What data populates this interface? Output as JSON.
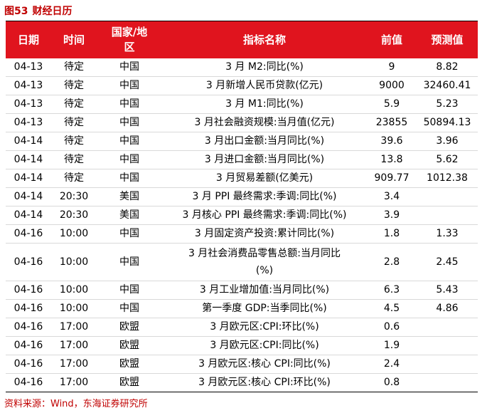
{
  "figure": {
    "number": "图53",
    "title": "财经日历"
  },
  "table": {
    "headers": [
      "日期",
      "时间",
      "国家/地区",
      "指标名称",
      "前值",
      "预测值"
    ],
    "rows": [
      [
        "04-13",
        "待定",
        "中国",
        "3 月 M2:同比(%)",
        "9",
        "8.82"
      ],
      [
        "04-13",
        "待定",
        "中国",
        "3 月新增人民币贷款(亿元)",
        "9000",
        "32460.41"
      ],
      [
        "04-13",
        "待定",
        "中国",
        "3 月 M1:同比(%)",
        "5.9",
        "5.23"
      ],
      [
        "04-13",
        "待定",
        "中国",
        "3 月社会融资规模:当月值(亿元)",
        "23855",
        "50894.13"
      ],
      [
        "04-14",
        "待定",
        "中国",
        "3 月出口金额:当月同比(%)",
        "39.6",
        "3.96"
      ],
      [
        "04-14",
        "待定",
        "中国",
        "3 月进口金额:当月同比(%)",
        "13.8",
        "5.62"
      ],
      [
        "04-14",
        "待定",
        "中国",
        "3 月贸易差额(亿美元)",
        "909.77",
        "1012.38"
      ],
      [
        "04-14",
        "20:30",
        "美国",
        "3 月 PPI 最终需求:季调:同比(%)",
        "3.4",
        ""
      ],
      [
        "04-14",
        "20:30",
        "美国",
        "3 月核心 PPI 最终需求:季调:同比(%)",
        "3.9",
        ""
      ],
      [
        "04-16",
        "10:00",
        "中国",
        "3 月固定资产投资:累计同比(%)",
        "1.8",
        "1.33"
      ],
      [
        "04-16",
        "10:00",
        "中国",
        "3 月社会消费品零售总额:当月同比(%)",
        "2.8",
        "2.45"
      ],
      [
        "04-16",
        "10:00",
        "中国",
        "3 月工业增加值:当月同比(%)",
        "6.3",
        "5.43"
      ],
      [
        "04-16",
        "10:00",
        "中国",
        "第一季度 GDP:当季同比(%)",
        "4.5",
        "4.86"
      ],
      [
        "04-16",
        "17:00",
        "欧盟",
        "3 月欧元区:CPI:环比(%)",
        "0.6",
        ""
      ],
      [
        "04-16",
        "17:00",
        "欧盟",
        "3 月欧元区:CPI:同比(%)",
        "1.9",
        ""
      ],
      [
        "04-16",
        "17:00",
        "欧盟",
        "3 月欧元区:核心 CPI:同比(%)",
        "2.4",
        ""
      ],
      [
        "04-16",
        "17:00",
        "欧盟",
        "3 月欧元区:核心 CPI:环比(%)",
        "0.8",
        ""
      ]
    ]
  },
  "source": "资料来源：Wind，东海证券研究所",
  "colors": {
    "accent": "#e0141e",
    "title_text": "#c00000"
  }
}
